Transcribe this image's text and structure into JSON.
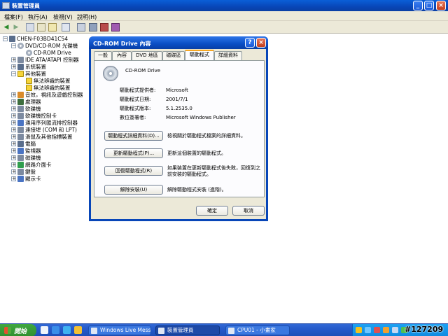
{
  "window": {
    "title": "裝置管理員"
  },
  "menu": [
    "檔案(F)",
    "執行(A)",
    "檢視(V)",
    "說明(H)"
  ],
  "tree": {
    "root": "CHEN-F03BD41C54",
    "nodes": [
      {
        "label": "DVD/CD-ROM 光碟機",
        "level": 1,
        "expanded": true,
        "icon": "cdrom-icon"
      },
      {
        "label": "CD-ROM Drive",
        "level": 2,
        "icon": "cdrom-icon"
      },
      {
        "label": "IDE ATA/ATAPI 控制器",
        "level": 1,
        "icon": "ide-icon"
      },
      {
        "label": "系統裝置",
        "level": 1,
        "icon": "computer-icon"
      },
      {
        "label": "其他裝置",
        "level": 1,
        "expanded": true,
        "icon": "warning-icon"
      },
      {
        "label": "無法辨識的裝置",
        "level": 2,
        "icon": "warning-icon"
      },
      {
        "label": "無法辨識的裝置",
        "level": 2,
        "icon": "warning-icon"
      },
      {
        "label": "音效，視訊及遊戲控制器",
        "level": 1,
        "icon": "sound-icon"
      },
      {
        "label": "處理器",
        "level": 1,
        "icon": "chip-icon"
      },
      {
        "label": "軟碟機",
        "level": 1,
        "icon": "floppy-icon"
      },
      {
        "label": "軟碟機控制卡",
        "level": 1,
        "icon": "floppy-icon"
      },
      {
        "label": "通用序列匯流排控制器",
        "level": 1,
        "icon": "usb-icon"
      },
      {
        "label": "連接埠 (COM 和 LPT)",
        "level": 1,
        "icon": "port-icon"
      },
      {
        "label": "滑鼠及其他指標裝置",
        "level": 1,
        "icon": "mouse-icon"
      },
      {
        "label": "電腦",
        "level": 1,
        "icon": "computer-icon"
      },
      {
        "label": "監視器",
        "level": 1,
        "icon": "monitor-icon"
      },
      {
        "label": "磁碟機",
        "level": 1,
        "icon": "disk-icon"
      },
      {
        "label": "網路介面卡",
        "level": 1,
        "icon": "network-icon"
      },
      {
        "label": "鍵盤",
        "level": 1,
        "icon": "keyboard-icon"
      },
      {
        "label": "顯示卡",
        "level": 1,
        "icon": "display-icon"
      }
    ]
  },
  "dialog": {
    "title": "CD-ROM Drive 內容",
    "tabs": [
      "一般",
      "內容",
      "DVD 地區",
      "磁碟區",
      "驅動程式",
      "詳細資料"
    ],
    "active_tab": "驅動程式",
    "device_name": "CD-ROM Drive",
    "fields": [
      {
        "label": "驅動程式提供者:",
        "value": "Microsoft"
      },
      {
        "label": "驅動程式日期:",
        "value": "2001/7/1"
      },
      {
        "label": "驅動程式版本:",
        "value": "5.1.2535.0"
      },
      {
        "label": "數位簽署者:",
        "value": "Microsoft Windows Publisher"
      }
    ],
    "actions": [
      {
        "button": "驅動程式詳細資料(D)...",
        "desc": "檢視關於驅動程式檔案的詳細資料。"
      },
      {
        "button": "更新驅動程式(P)...",
        "desc": "更新這個裝置的驅動程式。"
      },
      {
        "button": "回復驅動程式(R)",
        "desc": "如果裝置在更新驅動程式後失敗，回復到之前安裝的驅動程式。"
      },
      {
        "button": "解除安裝(U)",
        "desc": "解除驅動程式安裝 (進階)。"
      }
    ],
    "ok_label": "確定",
    "cancel_label": "取消"
  },
  "taskbar": {
    "start_label": "開始",
    "tasks": [
      "Windows Live Messen...",
      "裝置管理員",
      "CPU01 - 小畫家"
    ],
    "active_task": "裝置管理員"
  },
  "watermark": "#127209"
}
